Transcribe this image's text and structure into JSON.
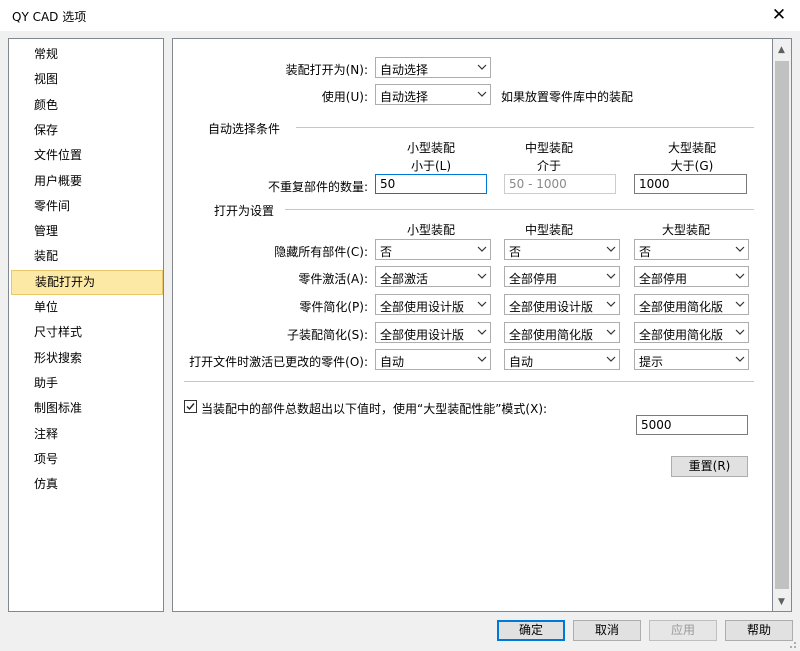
{
  "window": {
    "title": "QY CAD 选项",
    "close_symbol": "✕"
  },
  "sidebar": {
    "items": [
      "常规",
      "视图",
      "颜色",
      "保存",
      "文件位置",
      "用户概要",
      "零件间",
      "管理",
      "装配",
      "装配打开为",
      "单位",
      "尺寸样式",
      "形状搜索",
      "助手",
      "制图标准",
      "注释",
      "项号",
      "仿真"
    ],
    "selected_index": 9
  },
  "top": {
    "open_as_label": "装配打开为(N):",
    "open_as_value": "自动选择",
    "use_label": "使用(U):",
    "use_value": "自动选择",
    "use_hint": "如果放置零件库中的装配"
  },
  "auto_section": {
    "title": "自动选择条件",
    "headers": [
      {
        "name": "小型装配",
        "op": "小于(L)"
      },
      {
        "name": "中型装配",
        "op": "介于"
      },
      {
        "name": "大型装配",
        "op": "大于(G)"
      }
    ],
    "count_label": "不重复部件的数量:",
    "small_value": "50",
    "medium_value": "50 - 1000",
    "large_value": "1000"
  },
  "open_section": {
    "title": "打开为设置",
    "headers": [
      "小型装配",
      "中型装配",
      "大型装配"
    ],
    "rows": [
      {
        "label": "隐藏所有部件(C):",
        "values": [
          "否",
          "否",
          "否"
        ]
      },
      {
        "label": "零件激活(A):",
        "values": [
          "全部激活",
          "全部停用",
          "全部停用"
        ]
      },
      {
        "label": "零件简化(P):",
        "values": [
          "全部使用设计版",
          "全部使用设计版",
          "全部使用简化版"
        ]
      },
      {
        "label": "子装配简化(S):",
        "values": [
          "全部使用设计版",
          "全部使用简化版",
          "全部使用简化版"
        ]
      },
      {
        "label": "打开文件时激活已更改的零件(O):",
        "values": [
          "自动",
          "自动",
          "提示"
        ]
      }
    ]
  },
  "large_mode": {
    "checked": true,
    "label": "当装配中的部件总数超出以下值时，使用“大型装配性能”模式(X):",
    "threshold": "5000"
  },
  "reset_label": "重置(R)",
  "footer": {
    "ok": "确定",
    "cancel": "取消",
    "apply": "应用",
    "help": "帮助"
  },
  "colors": {
    "selection": "#fde9a6",
    "focus": "#0078d7"
  }
}
